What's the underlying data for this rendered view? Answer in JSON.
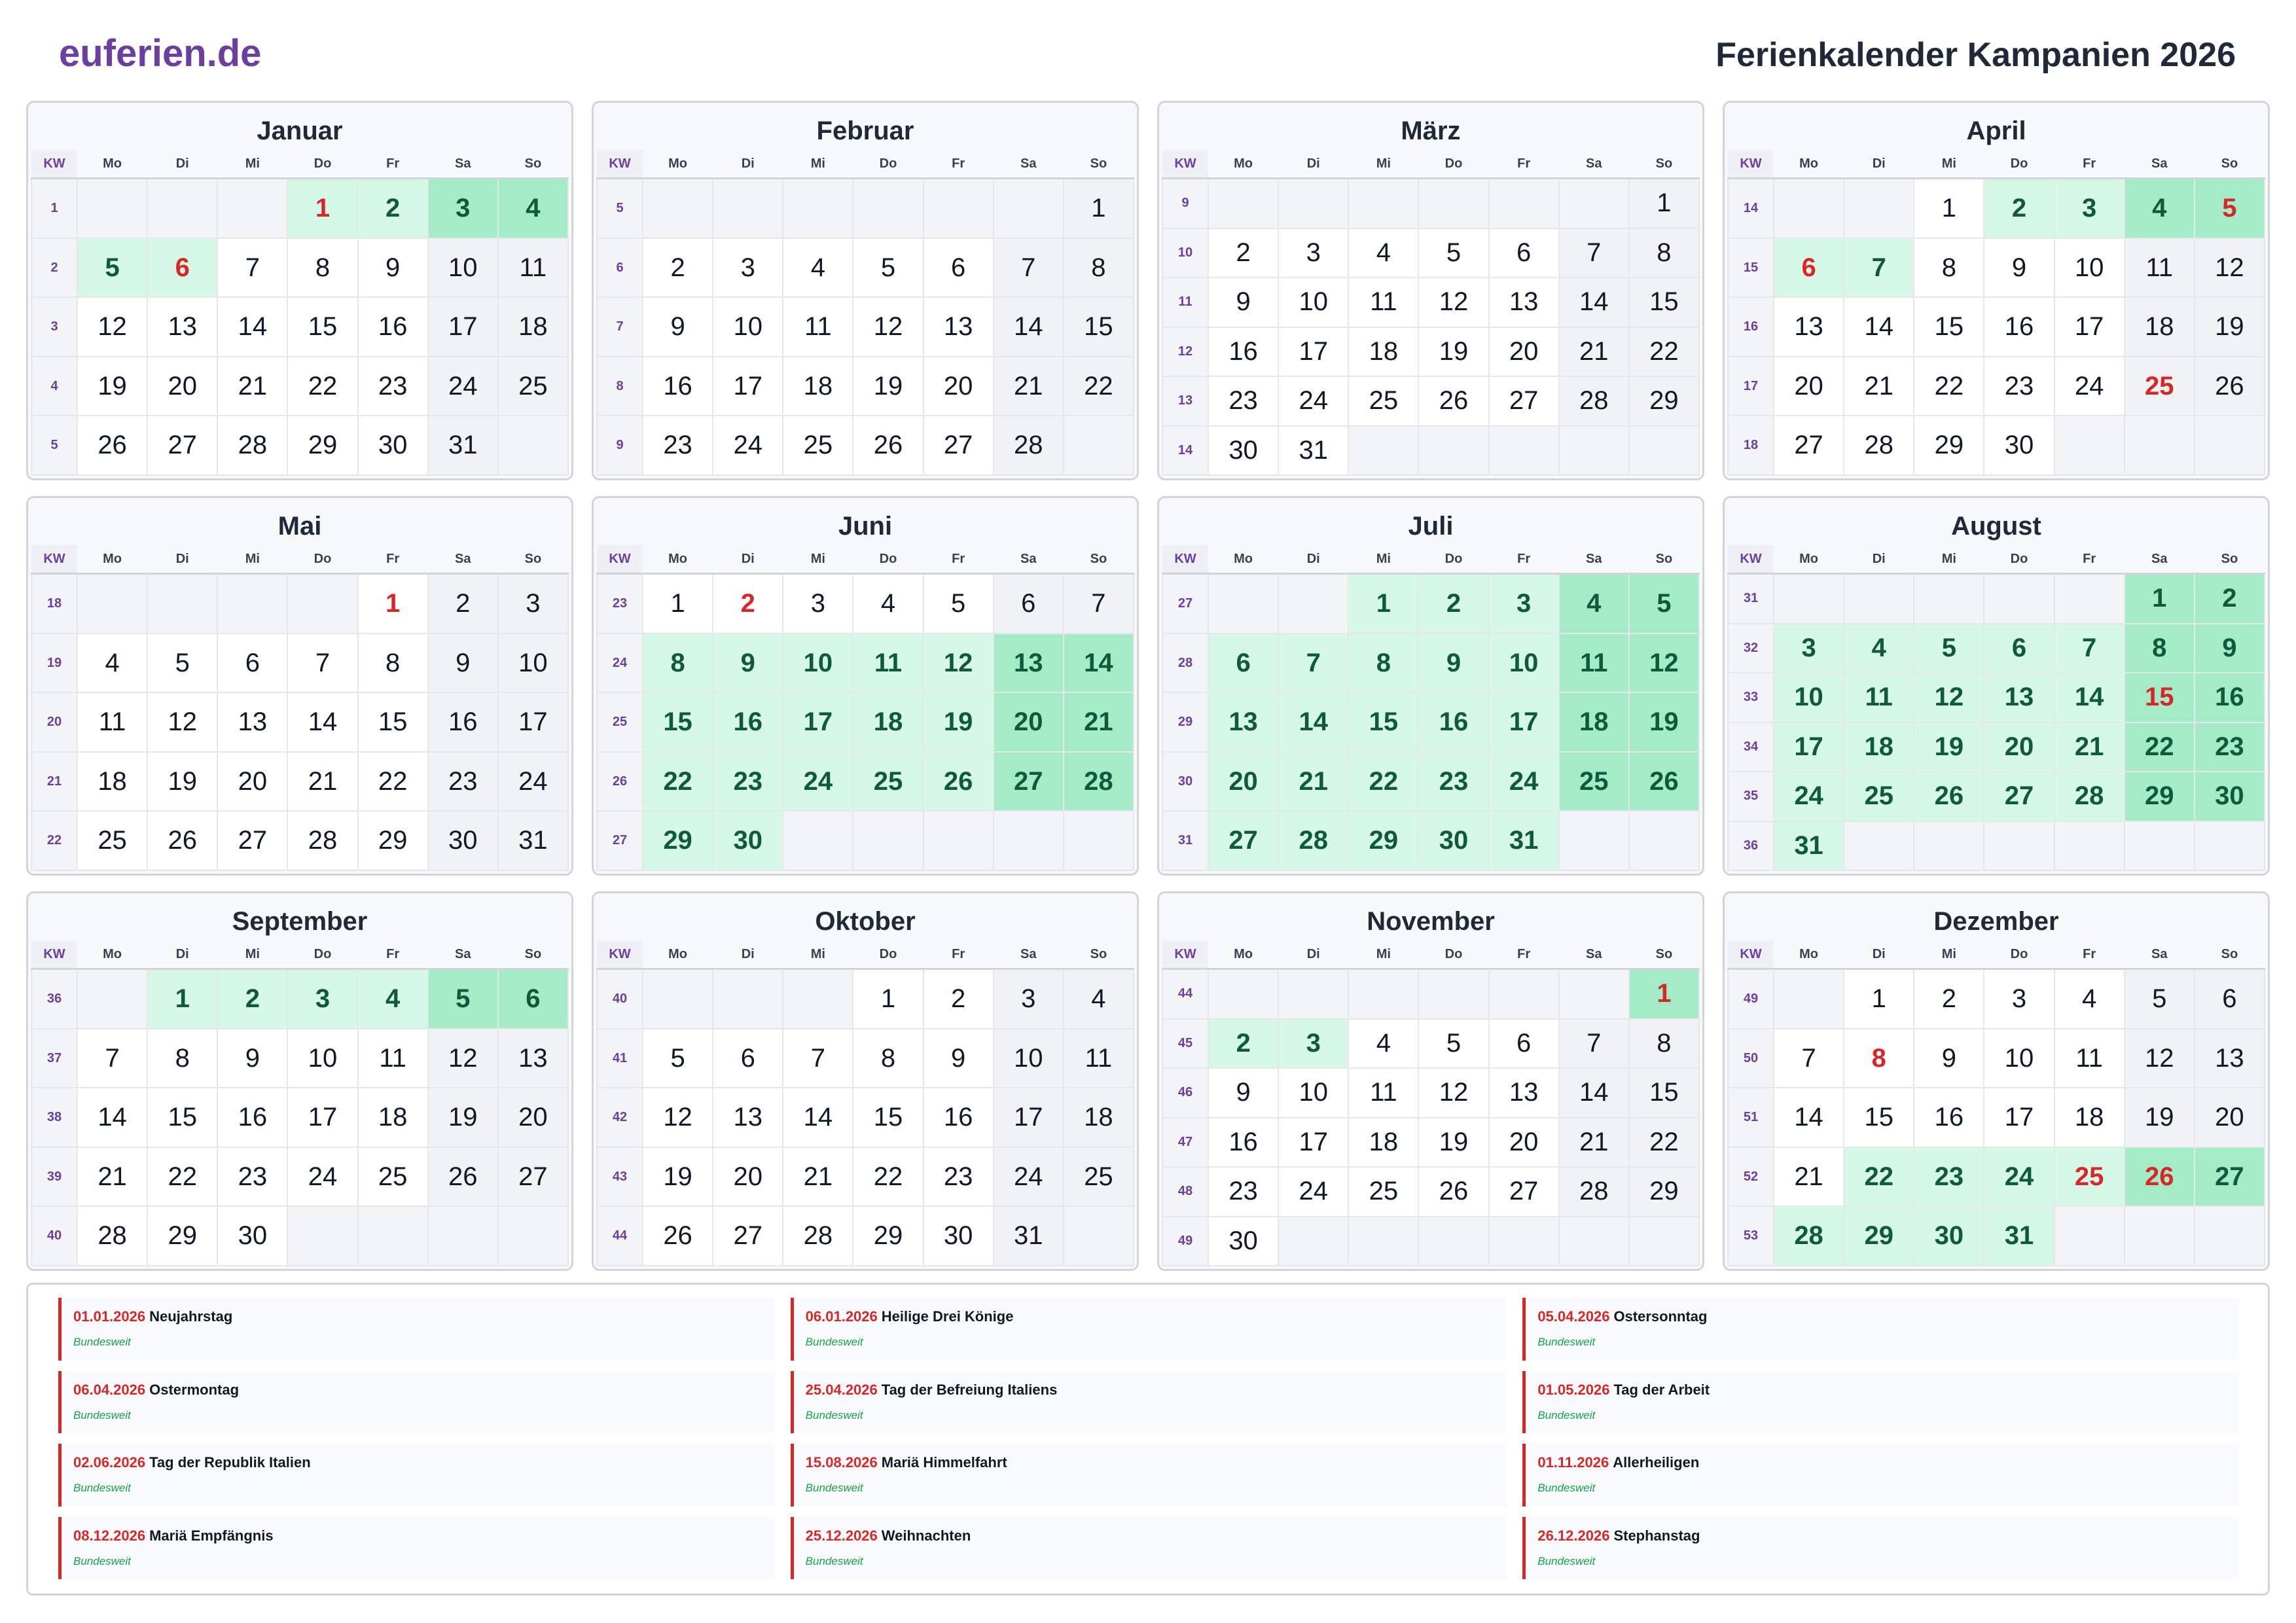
{
  "header": {
    "brand": "euferien.de",
    "title": "Ferienkalender Kampanien 2026"
  },
  "calendar": {
    "kw_label": "KW",
    "weekdays": [
      "Mo",
      "Di",
      "Mi",
      "Do",
      "Fr",
      "Sa",
      "So"
    ],
    "months": [
      {
        "name": "Januar",
        "kw": [
          1,
          2,
          3,
          4,
          5
        ],
        "lead": 3,
        "days": 31,
        "vacation": [
          1,
          2,
          3,
          4,
          5,
          6
        ],
        "holidays": [
          1,
          6
        ]
      },
      {
        "name": "Februar",
        "kw": [
          5,
          6,
          7,
          8,
          9
        ],
        "lead": 6,
        "days": 28,
        "vacation": [],
        "holidays": []
      },
      {
        "name": "März",
        "kw": [
          9,
          10,
          11,
          12,
          13,
          14
        ],
        "lead": 6,
        "days": 31,
        "vacation": [],
        "holidays": []
      },
      {
        "name": "April",
        "kw": [
          14,
          15,
          16,
          17,
          18
        ],
        "lead": 2,
        "days": 30,
        "vacation": [
          2,
          3,
          4,
          5,
          6,
          7
        ],
        "holidays": [
          5,
          6,
          25
        ]
      },
      {
        "name": "Mai",
        "kw": [
          18,
          19,
          20,
          21,
          22
        ],
        "lead": 4,
        "days": 31,
        "vacation": [],
        "holidays": [
          1
        ]
      },
      {
        "name": "Juni",
        "kw": [
          23,
          24,
          25,
          26,
          27
        ],
        "lead": 0,
        "days": 30,
        "vacation": [
          8,
          9,
          10,
          11,
          12,
          13,
          14,
          15,
          16,
          17,
          18,
          19,
          20,
          21,
          22,
          23,
          24,
          25,
          26,
          27,
          28,
          29,
          30
        ],
        "holidays": [
          2
        ]
      },
      {
        "name": "Juli",
        "kw": [
          27,
          28,
          29,
          30,
          31
        ],
        "lead": 2,
        "days": 31,
        "vacation": [
          1,
          2,
          3,
          4,
          5,
          6,
          7,
          8,
          9,
          10,
          11,
          12,
          13,
          14,
          15,
          16,
          17,
          18,
          19,
          20,
          21,
          22,
          23,
          24,
          25,
          26,
          27,
          28,
          29,
          30,
          31
        ],
        "holidays": []
      },
      {
        "name": "August",
        "kw": [
          31,
          32,
          33,
          34,
          35,
          36
        ],
        "lead": 5,
        "days": 31,
        "vacation": [
          1,
          2,
          3,
          4,
          5,
          6,
          7,
          8,
          9,
          10,
          11,
          12,
          13,
          14,
          15,
          16,
          17,
          18,
          19,
          20,
          21,
          22,
          23,
          24,
          25,
          26,
          27,
          28,
          29,
          30,
          31
        ],
        "holidays": [
          15
        ]
      },
      {
        "name": "September",
        "kw": [
          36,
          37,
          38,
          39,
          40
        ],
        "lead": 1,
        "days": 30,
        "vacation": [
          1,
          2,
          3,
          4,
          5,
          6
        ],
        "holidays": []
      },
      {
        "name": "Oktober",
        "kw": [
          40,
          41,
          42,
          43,
          44
        ],
        "lead": 3,
        "days": 31,
        "vacation": [],
        "holidays": []
      },
      {
        "name": "November",
        "kw": [
          44,
          45,
          46,
          47,
          48,
          49
        ],
        "lead": 6,
        "days": 30,
        "vacation": [
          1,
          2,
          3
        ],
        "holidays": [
          1
        ]
      },
      {
        "name": "Dezember",
        "kw": [
          49,
          50,
          51,
          52,
          53
        ],
        "lead": 1,
        "days": 31,
        "vacation": [
          22,
          23,
          24,
          25,
          26,
          27,
          28,
          29,
          30,
          31
        ],
        "holidays": [
          8,
          25,
          26
        ]
      }
    ]
  },
  "holidays": [
    {
      "date": "01.01.2026",
      "name": "Neujahrstag",
      "scope": "Bundesweit"
    },
    {
      "date": "06.01.2026",
      "name": "Heilige Drei Könige",
      "scope": "Bundesweit"
    },
    {
      "date": "05.04.2026",
      "name": "Ostersonntag",
      "scope": "Bundesweit"
    },
    {
      "date": "06.04.2026",
      "name": "Ostermontag",
      "scope": "Bundesweit"
    },
    {
      "date": "25.04.2026",
      "name": "Tag der Befreiung Italiens",
      "scope": "Bundesweit"
    },
    {
      "date": "01.05.2026",
      "name": "Tag der Arbeit",
      "scope": "Bundesweit"
    },
    {
      "date": "02.06.2026",
      "name": "Tag der Republik Italien",
      "scope": "Bundesweit"
    },
    {
      "date": "15.08.2026",
      "name": "Mariä Himmelfahrt",
      "scope": "Bundesweit"
    },
    {
      "date": "01.11.2026",
      "name": "Allerheiligen",
      "scope": "Bundesweit"
    },
    {
      "date": "08.12.2026",
      "name": "Mariä Empfängnis",
      "scope": "Bundesweit"
    },
    {
      "date": "25.12.2026",
      "name": "Weihnachten",
      "scope": "Bundesweit"
    },
    {
      "date": "26.12.2026",
      "name": "Stephanstag",
      "scope": "Bundesweit"
    }
  ],
  "colors": {
    "brand": "#6b3fa0",
    "holiday": "#d62828",
    "vacation": "#d6f8e6",
    "vacation_weekend": "#a4ecc8",
    "scope": "#16a34a"
  }
}
